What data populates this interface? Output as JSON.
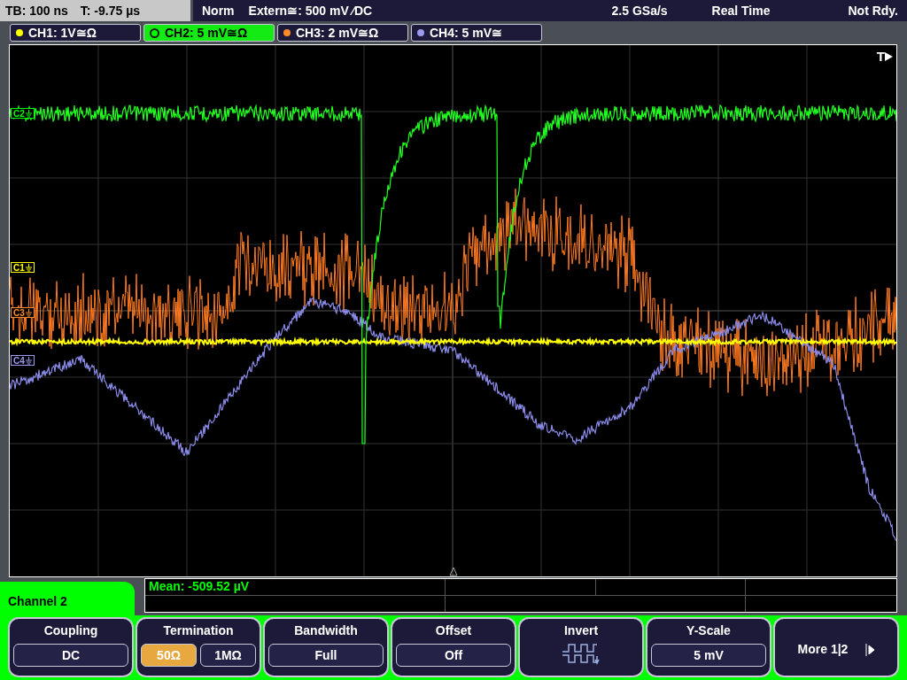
{
  "status_bar": {
    "timebase": "TB: 100 ns",
    "trigger_time": "T: -9.75 µs",
    "mode": "Norm",
    "trigger_source": "Extern≅: 500 mV ⁄DC",
    "sample_rate": "2.5 GSa/s",
    "acquisition": "Real Time",
    "state": "Not Rdy."
  },
  "channels": [
    {
      "label": "CH1: 1V≅Ω",
      "color": "#ffff00",
      "selected": false
    },
    {
      "label": "CH2: 5 mV≅Ω",
      "color": "#00ff00",
      "selected": true
    },
    {
      "label": "CH3: 2 mV≅Ω",
      "color": "#ff8c2a",
      "selected": false
    },
    {
      "label": "CH4: 5 mV≅",
      "color": "#9a9aee",
      "selected": false
    }
  ],
  "trigger_marker": "T",
  "markers": [
    {
      "label": "C2",
      "color": "#00ff00"
    },
    {
      "label": "C1",
      "color": "#ffff00"
    },
    {
      "label": "C3",
      "color": "#ff8c2a"
    },
    {
      "label": "C4",
      "color": "#9a9aee"
    }
  ],
  "measurement": "Mean: -509.52 µV",
  "menu": {
    "title": "Channel 2",
    "softkeys": [
      {
        "kind": "value",
        "title": "Coupling",
        "value": "DC"
      },
      {
        "kind": "toggle",
        "title": "Termination",
        "options": [
          {
            "label": "50Ω",
            "selected": true
          },
          {
            "label": "1MΩ",
            "selected": false
          }
        ]
      },
      {
        "kind": "value",
        "title": "Bandwidth",
        "value": "Full"
      },
      {
        "kind": "value",
        "title": "Offset",
        "value": "Off"
      },
      {
        "kind": "icon",
        "title": "Invert"
      },
      {
        "kind": "value",
        "title": "Y-Scale",
        "value": "5 mV"
      },
      {
        "kind": "more",
        "title": "More 1|2"
      }
    ]
  }
}
